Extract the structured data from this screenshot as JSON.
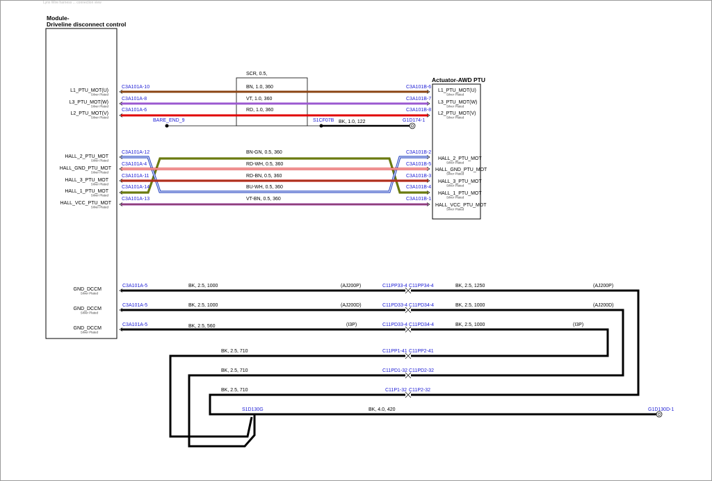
{
  "header": {
    "text": "Lynx  Wire  harness  ...  connection  view"
  },
  "module": {
    "title_line1": "Module-",
    "title_line2": "Driveline disconnect control"
  },
  "actuator": {
    "title": "Actuator-AWD PTU"
  },
  "plating": "Silver Plated",
  "motor_pins": [
    "L1_PTU_MOT(U)",
    "L3_PTU_MOT(W)",
    "L2_PTU_MOT(V)"
  ],
  "hall_pins": [
    "HALL_2_PTU_MOT",
    "HALL_GND_PTU_MOT",
    "HALL_3_PTU_MOT",
    "HALL_1_PTU_MOT",
    "HALL_VCC_PTU_MOT"
  ],
  "actuator_pins": [
    "L1_PTU_MOT(U)",
    "L3_PTU_MOT(W)",
    "L2_PTU_MOT(V)",
    "HALL_2_PTU_MOT",
    "HALL_GND_PTU_MOT",
    "HALL_3_PTU_MOT",
    "HALL_1_PTU_MOT",
    "HALL_VCC_PTU_MOT"
  ],
  "gnd_pins": [
    "GND_DCCM",
    "GND_DCCM",
    "GND_DCCM"
  ],
  "shield": {
    "label": "SCR,  0.5,",
    "bare_end": "BARE_END_9",
    "splice": "S1CF07B",
    "ground_wire": "BK,  1.0,  122",
    "ground_point": "G1D174-1"
  },
  "motor_wires": [
    {
      "left": "C3A101A-10",
      "spec": "BN,  1.0,  360",
      "right": "C3A101B-6",
      "color": "#8b4513"
    },
    {
      "left": "C3A101A-8",
      "spec": "VT,  1.0,  360",
      "right": "C3A101B-7",
      "color": "#9b59d0"
    },
    {
      "left": "C3A101A-6",
      "spec": "RD,  1.0,  360",
      "right": "C3A101B-8",
      "color": "#e00000"
    }
  ],
  "hall_wires": [
    {
      "left": "C3A101A-12",
      "spec": "BN-GN,  0.5,  360",
      "right": "C3A101B-2",
      "color": "#6b7a10"
    },
    {
      "left": "C3A101A-4",
      "spec": "RD-WH,  0.5,  360",
      "right": "C3A101B-5",
      "color": "#e03030"
    },
    {
      "left": "C3A101A-11",
      "spec": "RD-BN,  0.5,  360",
      "right": "C3A101B-3",
      "color": "#c8281e"
    },
    {
      "left": "C3A101A-14",
      "spec": "BU-WH,  0.5,  360",
      "right": "C3A101B-4",
      "color": "#2040c0"
    },
    {
      "left": "C3A101A-13",
      "spec": "VT-BN,  0.5,  360",
      "right": "C3A101B-1",
      "color": "#9b3aa8"
    }
  ],
  "gnd_wires": [
    {
      "left": "C3A101A-5",
      "spec1": "BK,  2.5,  1000",
      "loc1": "(AJ200P)",
      "inline1": "C11PP33-4",
      "inline2": "C11PP34-4",
      "spec2": "BK,  2.5,  1250",
      "loc2": "(AJ200P)"
    },
    {
      "left": "C3A101A-5",
      "spec1": "BK,  2.5,  1000",
      "loc1": "(AJ200D)",
      "inline1": "C11PD33-4",
      "inline2": "C11PD34-4",
      "spec2": "BK,  2.5,  1000",
      "loc2": "(AJ200D)"
    },
    {
      "left": "C3A101A-5",
      "spec1": "BK,  2.5,  560",
      "loc1": "(I3P)",
      "inline1": "C11PD33-4",
      "inline2": "C11PD34-4",
      "spec2": "BK,  2.5,  1000",
      "loc2": "(I3P)"
    }
  ],
  "return_wires": [
    {
      "spec": "BK,  2.5,  710",
      "inline1": "C11PP1-41",
      "inline2": "C11PP2-41"
    },
    {
      "spec": "BK,  2.5,  710",
      "inline1": "C11PD1-32",
      "inline2": "C11PD2-32"
    },
    {
      "spec": "BK,  2.5,  710",
      "inline1": "C11P1-32",
      "inline2": "C11P2-32"
    }
  ],
  "ground_bus": {
    "splice": "S1D130G",
    "spec": "BK,  4.0,  420",
    "ground_point": "G1D130D-1"
  }
}
